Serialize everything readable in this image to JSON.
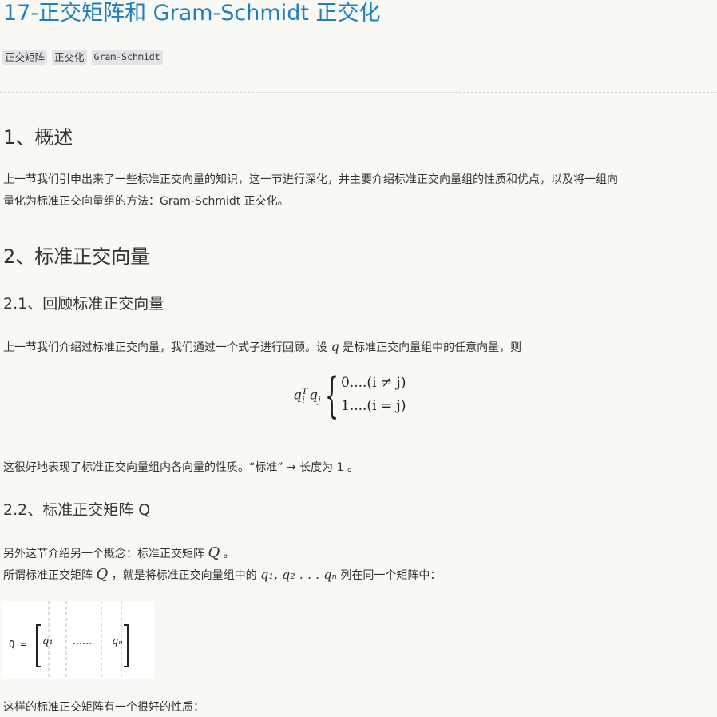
{
  "article": {
    "title": "17-正交矩阵和 Gram-Schmidt 正交化",
    "tags": [
      "正交矩阵",
      "正交化",
      "Gram-Schmidt"
    ]
  },
  "sections": {
    "s1_heading": "1、概述",
    "s1_para_line1": "上一节我们引申出来了一些标准正交向量的知识，这一节进行深化，并主要介绍标准正交向量组的性质和优点，以及将一组向",
    "s1_para_line2": "量化为标准正交向量组的方法：Gram-Schmidt 正交化。",
    "s2_heading": "2、标准正交向量",
    "s21_heading": "2.1、回顾标准正交向量",
    "s21_para_before": "上一节我们介绍过标准正交向量，我们通过一个式子进行回顾。设",
    "s21_var": "q",
    "s21_para_after": "是标准正交向量组中的任意向量，则",
    "formula_lhs": "q",
    "formula_sup": "T",
    "formula_sub_i": "i",
    "formula_q2": "q",
    "formula_sub_j": "j",
    "formula_case1": "0....(i ≠ j)",
    "formula_case2": "1....(i = j)",
    "s21_after_formula": "这很好地表现了标准正交向量组内各向量的性质。“标准” → 长度为 1 。",
    "s22_heading": "2.2、标准正交矩阵 Q",
    "s22_line1_before": "另外这节介绍另一个概念：标准正交矩阵",
    "s22_line1_var": "Q",
    "s22_line1_after": "。",
    "s22_line2_before": "所谓标准正交矩阵",
    "s22_line2_var": "Q",
    "s22_line2_mid": "，就是将标准正交向量组中的",
    "s22_line2_vars": "q₁, q₂ . . . qₙ",
    "s22_line2_after": "列在同一个矩阵中：",
    "matrix_label": "Q  =",
    "matrix_q1": "q₁",
    "matrix_dots": "……",
    "matrix_qn": "qₙ",
    "last_line": "这样的标准正交矩阵有一个很好的性质："
  }
}
